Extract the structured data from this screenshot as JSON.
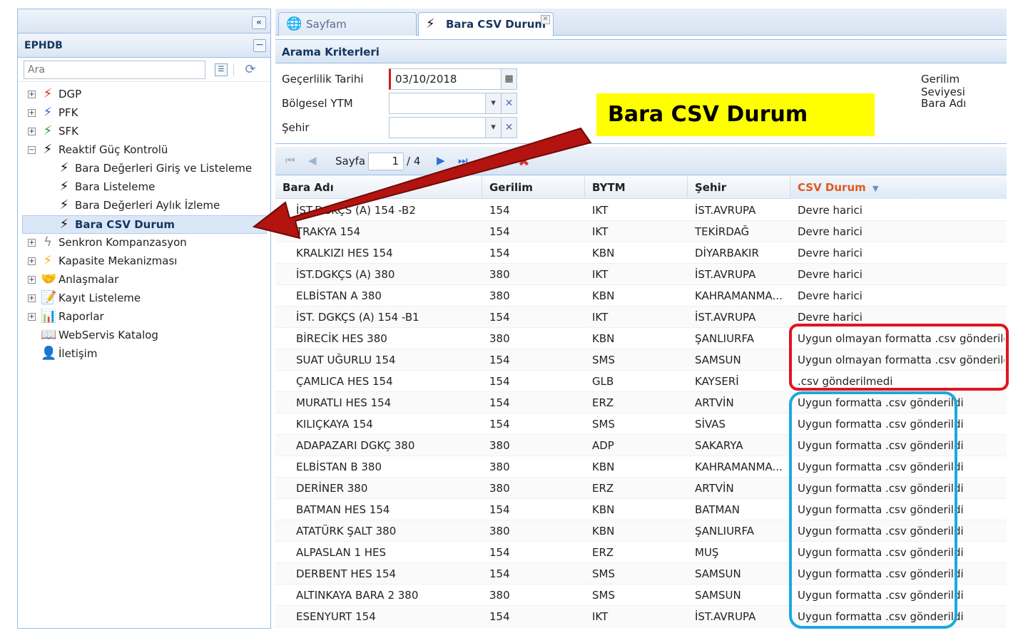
{
  "left_panel": {
    "collapse_icon": "double-chevron-left-icon",
    "title": "EPHDB",
    "search_placeholder": "Ara",
    "tree": [
      {
        "label": "DGP",
        "icon": "lightning-red-icon",
        "color": "#e0251b",
        "expandable": true,
        "expanded": false,
        "level": 0
      },
      {
        "label": "PFK",
        "icon": "lightning-blue-icon",
        "color": "#2e6fd6",
        "expandable": true,
        "expanded": false,
        "level": 0
      },
      {
        "label": "SFK",
        "icon": "lightning-green-icon",
        "color": "#2e9a3a",
        "expandable": true,
        "expanded": false,
        "level": 0
      },
      {
        "label": "Reaktif Güç Kontrolü",
        "icon": "lightning-black-icon",
        "color": "#111111",
        "expandable": true,
        "expanded": true,
        "level": 0
      },
      {
        "label": "Bara Değerleri Giriş ve Listeleme",
        "icon": "lightning-black-icon",
        "color": "#111111",
        "level": 1
      },
      {
        "label": "Bara Listeleme",
        "icon": "lightning-black-icon",
        "color": "#111111",
        "level": 1
      },
      {
        "label": "Bara Değerleri Aylık İzleme",
        "icon": "lightning-black-icon",
        "color": "#111111",
        "level": 1
      },
      {
        "label": "Bara CSV Durum",
        "icon": "lightning-black-icon",
        "color": "#111111",
        "level": 1,
        "selected": true
      },
      {
        "label": "Senkron Kompanzasyon",
        "icon": "lightning-outline-icon",
        "color": "#8a8a8a",
        "expandable": true,
        "expanded": false,
        "level": 0
      },
      {
        "label": "Kapasite Mekanizması",
        "icon": "lightning-yellow-icon",
        "color": "#f2b705",
        "expandable": true,
        "expanded": false,
        "level": 0
      },
      {
        "label": "Anlaşmalar",
        "icon": "handshake-icon",
        "color": "#6c7a8c",
        "expandable": true,
        "expanded": false,
        "level": 0
      },
      {
        "label": "Kayıt Listeleme",
        "icon": "document-edit-icon",
        "color": "#7f94b3",
        "expandable": true,
        "expanded": false,
        "level": 0
      },
      {
        "label": "Raporlar",
        "icon": "chart-icon",
        "color": "#5d7fae",
        "expandable": true,
        "expanded": false,
        "level": 0
      },
      {
        "label": "WebServis Katalog",
        "icon": "book-icon",
        "color": "#5d7fae",
        "level": 0
      },
      {
        "label": "İletişim",
        "icon": "contact-icon",
        "color": "#4d78b8",
        "level": 0
      }
    ]
  },
  "tabs": [
    {
      "label": "Sayfam",
      "icon": "globe-icon"
    },
    {
      "label": "Bara CSV Durum",
      "icon": "lightning-black-icon",
      "active": true
    }
  ],
  "criteria": {
    "title": "Arama Kriterleri",
    "fields": {
      "validity_date_label": "Geçerlilik Tarihi",
      "validity_date_value": "03/10/2018",
      "regional_label": "Bölgesel YTM",
      "regional_value": "",
      "city_label": "Şehir",
      "city_value": "",
      "voltage_label": "Gerilim Seviyesi",
      "bara_name_label": "Bara Adı"
    }
  },
  "annotation": {
    "text": "Bara CSV Durum",
    "color": "#ffff00"
  },
  "pager": {
    "page_label": "Sayfa",
    "page_value": "1",
    "page_of": "/ 4"
  },
  "grid": {
    "columns": [
      "Bara Adı",
      "Gerilim",
      "BYTM",
      "Şehir",
      "CSV Durum"
    ],
    "sorted_column": "CSV Durum",
    "rows": [
      [
        "İST.DGKÇS (A) 154 -B2",
        "154",
        "IKT",
        "İST.AVRUPA",
        "Devre harici"
      ],
      [
        "TRAKYA 154",
        "154",
        "IKT",
        "TEKİRDAĞ",
        "Devre harici"
      ],
      [
        "KRALKIZI HES 154",
        "154",
        "KBN",
        "DİYARBAKIR",
        "Devre harici"
      ],
      [
        "İST.DGKÇS (A) 380",
        "380",
        "IKT",
        "İST.AVRUPA",
        "Devre harici"
      ],
      [
        "ELBİSTAN A 380",
        "380",
        "KBN",
        "KAHRAMANMA...",
        "Devre harici"
      ],
      [
        "İST. DGKÇS (A) 154 -B1",
        "154",
        "IKT",
        "İST.AVRUPA",
        "Devre harici"
      ],
      [
        "BİRECİK HES 380",
        "380",
        "KBN",
        "ŞANLIURFA",
        "Uygun olmayan formatta .csv gönderildi"
      ],
      [
        "SUAT UĞURLU 154",
        "154",
        "SMS",
        "SAMSUN",
        "Uygun olmayan formatta .csv gönderildi"
      ],
      [
        "ÇAMLICA HES 154",
        "154",
        "GLB",
        "KAYSERİ",
        ".csv gönderilmedi"
      ],
      [
        "MURATLI HES 154",
        "154",
        "ERZ",
        "ARTVİN",
        "Uygun formatta .csv gönderildi"
      ],
      [
        "KILIÇKAYA 154",
        "154",
        "SMS",
        "SİVAS",
        "Uygun formatta .csv gönderildi"
      ],
      [
        "ADAPAZARI DGKÇ 380",
        "380",
        "ADP",
        "SAKARYA",
        "Uygun formatta .csv gönderildi"
      ],
      [
        "ELBİSTAN B 380",
        "380",
        "KBN",
        "KAHRAMANMA...",
        "Uygun formatta .csv gönderildi"
      ],
      [
        "DERİNER 380",
        "380",
        "ERZ",
        "ARTVİN",
        "Uygun formatta .csv gönderildi"
      ],
      [
        "BATMAN HES 154",
        "154",
        "KBN",
        "BATMAN",
        "Uygun formatta .csv gönderildi"
      ],
      [
        "ATATÜRK ŞALT 380",
        "380",
        "KBN",
        "ŞANLIURFA",
        "Uygun formatta .csv gönderildi"
      ],
      [
        "ALPASLAN 1 HES",
        "154",
        "ERZ",
        "MUŞ",
        "Uygun formatta .csv gönderildi"
      ],
      [
        "DERBENT HES 154",
        "154",
        "SMS",
        "SAMSUN",
        "Uygun formatta .csv gönderildi"
      ],
      [
        "ALTINKAYA BARA 2 380",
        "380",
        "SMS",
        "SAMSUN",
        "Uygun formatta .csv gönderildi"
      ],
      [
        "ESENYURT 154",
        "154",
        "IKT",
        "İST.AVRUPA",
        "Uygun formatta .csv gönderildi"
      ]
    ]
  },
  "highlight_colors": {
    "invalid": "#e2141c",
    "valid": "#1ba9e1",
    "arrow": "#b3140f"
  }
}
